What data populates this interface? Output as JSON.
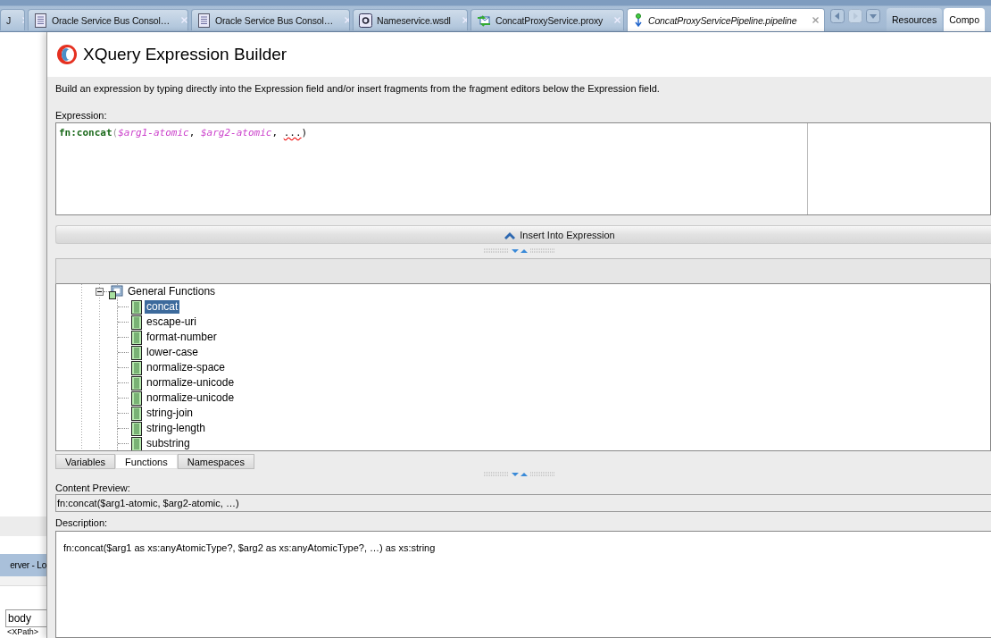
{
  "editor_tabs": [
    {
      "label": "J",
      "kind": "plain",
      "selected": false
    },
    {
      "label": "Oracle Service Bus Consol…",
      "kind": "document",
      "selected": false
    },
    {
      "label": "Oracle Service Bus Consol…",
      "kind": "document",
      "selected": false
    },
    {
      "label": "Nameservice.wsdl",
      "kind": "wsdl",
      "selected": false
    },
    {
      "label": "ConcatProxyService.proxy",
      "kind": "proxy",
      "selected": false
    },
    {
      "label": "ConcatProxyServicePipeline.pipeline",
      "kind": "pipeline",
      "selected": true
    }
  ],
  "side_tabs": [
    {
      "label": "Resources",
      "selected": false
    },
    {
      "label": "Compo",
      "selected": true
    }
  ],
  "left_panel": {
    "tab": "erver - Lo",
    "field_value": "body",
    "text": "<XPath>"
  },
  "dialog": {
    "title": "XQuery Expression Builder",
    "instructions": "Build an expression by typing directly into the Expression field and/or insert fragments from the fragment editors below the Expression field.",
    "expression_label": "Expression:",
    "expression": [
      {
        "text": "fn:concat",
        "kind": "function"
      },
      {
        "text": "(",
        "kind": "paren"
      },
      {
        "text": "$arg1-atomic",
        "kind": "variable"
      },
      {
        "text": ", ",
        "kind": "punct"
      },
      {
        "text": "$arg2-atomic",
        "kind": "variable"
      },
      {
        "text": ", ",
        "kind": "punct"
      },
      {
        "text": "...",
        "kind": "error"
      },
      {
        "text": ")",
        "kind": "punct"
      }
    ],
    "insert_button": "Insert Into Expression",
    "tree": [
      {
        "label": "General Functions",
        "expanded": true,
        "selected": false,
        "children": [
          {
            "label": "concat",
            "selected": true
          },
          {
            "label": "escape-uri",
            "selected": false
          },
          {
            "label": "format-number",
            "selected": false
          },
          {
            "label": "lower-case",
            "selected": false
          },
          {
            "label": "normalize-space",
            "selected": false
          },
          {
            "label": "normalize-unicode",
            "selected": false
          },
          {
            "label": "normalize-unicode",
            "selected": false
          },
          {
            "label": "string-join",
            "selected": false
          },
          {
            "label": "string-length",
            "selected": false
          },
          {
            "label": "substring",
            "selected": false
          }
        ]
      }
    ],
    "bottom_tabs": [
      {
        "label": "Variables",
        "selected": false
      },
      {
        "label": "Functions",
        "selected": true
      },
      {
        "label": "Namespaces",
        "selected": false
      }
    ],
    "preview_label": "Content Preview:",
    "preview_value": "fn:concat($arg1-atomic, $arg2-atomic, …)",
    "description_label": "Description:",
    "description": "fn:concat($arg1 as xs:anyAtomicType?, $arg2 as xs:anyAtomicType?, …) as xs:string"
  }
}
